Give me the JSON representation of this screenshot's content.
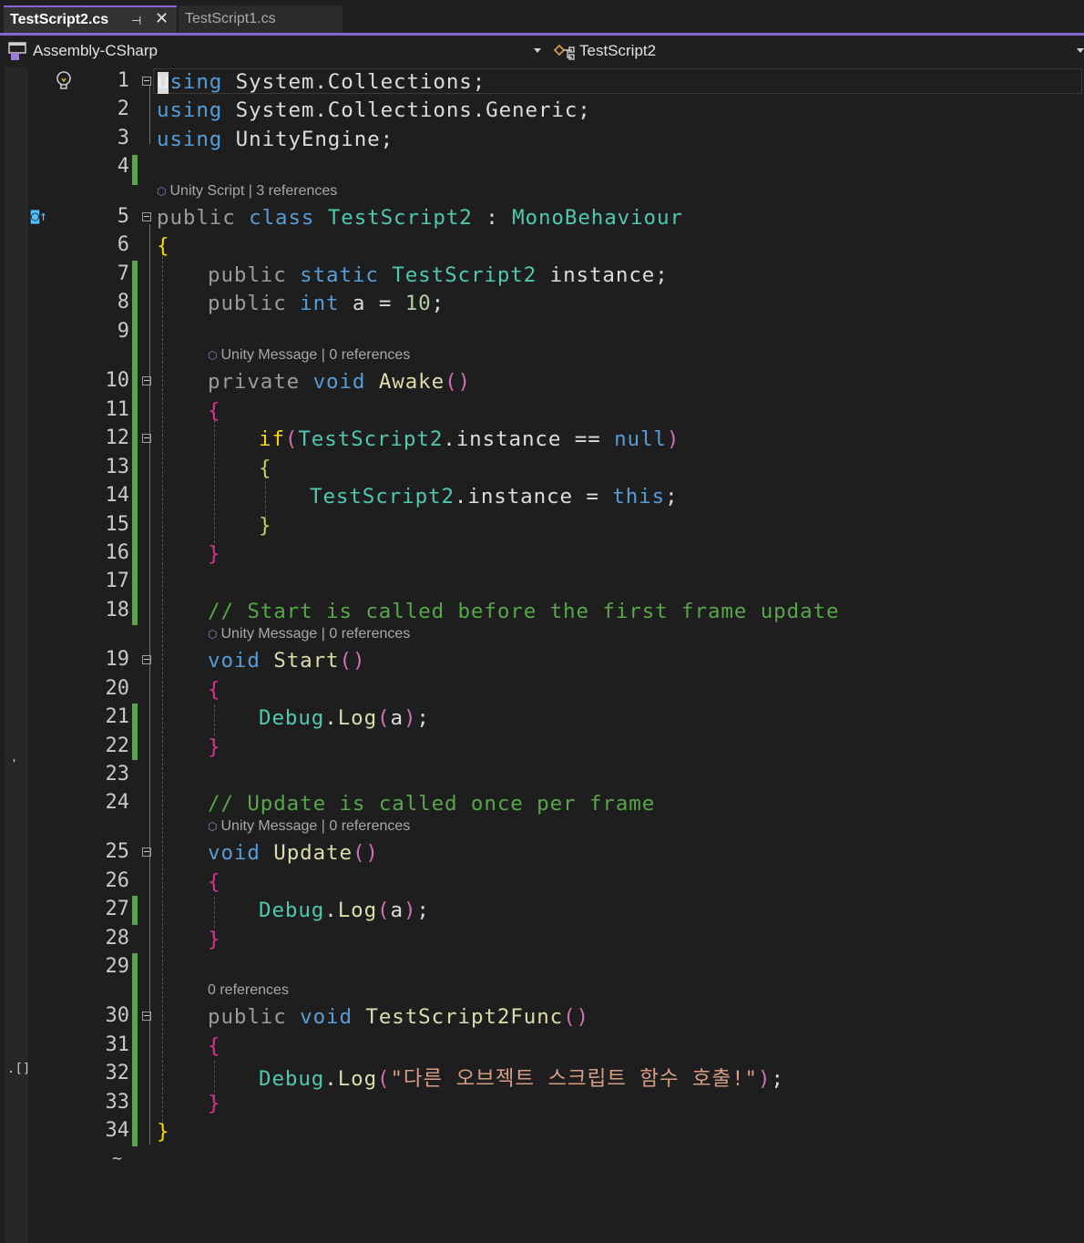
{
  "tabs": [
    {
      "label": "TestScript2.cs",
      "active": true
    },
    {
      "label": "TestScript1.cs",
      "active": false
    }
  ],
  "nav": {
    "project": "Assembly-CSharp",
    "type": "TestScript2"
  },
  "codelens": {
    "class": "Unity Script | 3 references",
    "awake": "Unity Message | 0 references",
    "start": "Unity Message | 0 references",
    "update": "Unity Message | 0 references",
    "func": "0 references"
  },
  "lines": {
    "l1": "using System.Collections;",
    "l2": "using System.Collections.Generic;",
    "l3": "using UnityEngine;",
    "l5": "public class TestScript2 : MonoBehaviour",
    "l7": "public static TestScript2 instance;",
    "l8": "public int a = 10;",
    "l10": "private void Awake()",
    "l12": "if(TestScript2.instance == null)",
    "l14": "TestScript2.instance = this;",
    "l18": "// Start is called before the first frame update",
    "l19": "void Start()",
    "l21": "Debug.Log(a);",
    "l24": "// Update is called once per frame",
    "l25": "void Update()",
    "l27": "Debug.Log(a);",
    "l30": "public void TestScript2Func()",
    "l32": "Debug.Log(\"다른 오브젝트 스크립트 함수 호출!\");"
  },
  "line_numbers": [
    "1",
    "2",
    "3",
    "4",
    "5",
    "6",
    "7",
    "8",
    "9",
    "10",
    "11",
    "12",
    "13",
    "14",
    "15",
    "16",
    "17",
    "18",
    "19",
    "20",
    "21",
    "22",
    "23",
    "24",
    "25",
    "26",
    "27",
    "28",
    "29",
    "30",
    "31",
    "32",
    "33",
    "34"
  ],
  "end_marker": "~",
  "margin_glyphs": {
    "ref": "[]",
    "dot": "'"
  },
  "colors": {
    "accent": "#8a63d2",
    "keyword": "#569cd6",
    "type": "#4ec9b0",
    "method": "#dcdcaa",
    "comment": "#57a64a",
    "string": "#d69d85",
    "change_bar": "#57a64a"
  },
  "icons": [
    "lightbulb-icon",
    "pin-icon",
    "close-icon",
    "project-icon",
    "class-icon",
    "chevron-down-icon",
    "bookmark-icon"
  ]
}
